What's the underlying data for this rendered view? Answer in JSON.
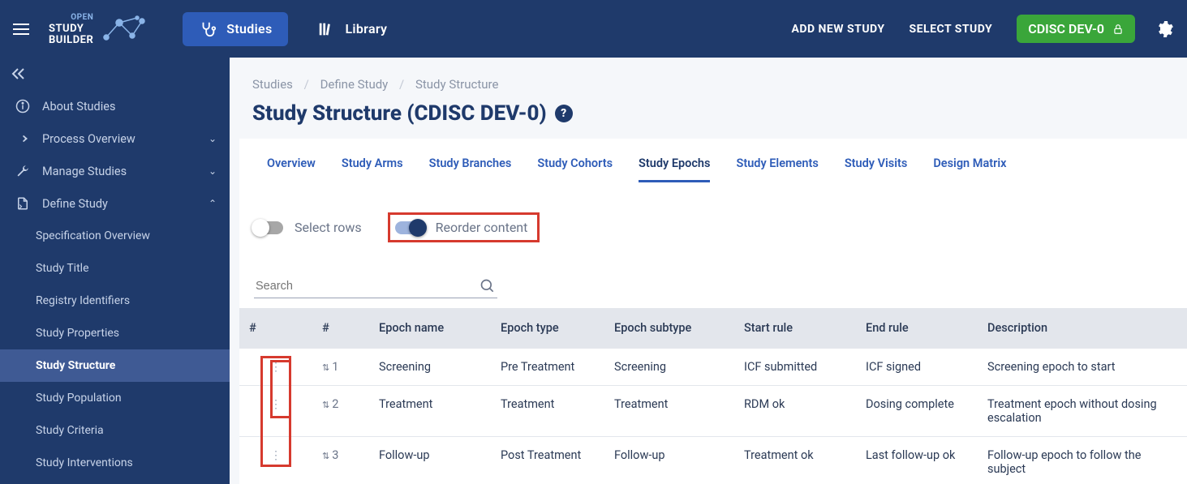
{
  "topbar": {
    "nav": {
      "studies": "Studies",
      "library": "Library"
    },
    "actions": {
      "add": "ADD NEW STUDY",
      "select": "SELECT STUDY"
    },
    "study_badge": "CDISC DEV-0"
  },
  "sidebar": {
    "items": [
      {
        "label": "About Studies",
        "icon": "info"
      },
      {
        "label": "Process Overview",
        "icon": "arrow",
        "expand": "down"
      },
      {
        "label": "Manage Studies",
        "icon": "wrench",
        "expand": "down"
      },
      {
        "label": "Define Study",
        "icon": "page",
        "expand": "up"
      }
    ],
    "subitems": [
      {
        "label": "Specification Overview"
      },
      {
        "label": "Study Title"
      },
      {
        "label": "Registry Identifiers"
      },
      {
        "label": "Study Properties"
      },
      {
        "label": "Study Structure",
        "active": true
      },
      {
        "label": "Study Population"
      },
      {
        "label": "Study Criteria"
      },
      {
        "label": "Study Interventions"
      }
    ]
  },
  "breadcrumb": [
    "Studies",
    "Define Study",
    "Study Structure"
  ],
  "page_title": "Study Structure (CDISC DEV-0)",
  "tabs": [
    "Overview",
    "Study Arms",
    "Study Branches",
    "Study Cohorts",
    "Study Epochs",
    "Study Elements",
    "Study Visits",
    "Design Matrix"
  ],
  "active_tab_index": 4,
  "toggles": {
    "select_rows": "Select rows",
    "reorder": "Reorder content"
  },
  "search": {
    "placeholder": "Search"
  },
  "table": {
    "headers": [
      "#",
      "#",
      "Epoch name",
      "Epoch type",
      "Epoch subtype",
      "Start rule",
      "End rule",
      "Description"
    ],
    "rows": [
      {
        "order": "1",
        "name": "Screening",
        "type": "Pre Treatment",
        "subtype": "Screening",
        "start": "ICF submitted",
        "end": "ICF signed",
        "desc": "Screening epoch to start"
      },
      {
        "order": "2",
        "name": "Treatment",
        "type": "Treatment",
        "subtype": "Treatment",
        "start": "RDM ok",
        "end": "Dosing complete",
        "desc": "Treatment epoch without dosing escalation"
      },
      {
        "order": "3",
        "name": "Follow-up",
        "type": "Post Treatment",
        "subtype": "Follow-up",
        "start": "Treatment ok",
        "end": "Last follow-up ok",
        "desc": "Follow-up epoch to follow the subject"
      }
    ]
  }
}
